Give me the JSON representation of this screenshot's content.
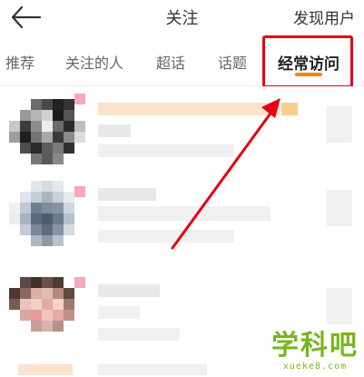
{
  "header": {
    "title": "关注",
    "discover_label": "发现用户",
    "back_icon": "arrow-left-icon"
  },
  "tabs": [
    {
      "label": "推荐"
    },
    {
      "label": "关注的人"
    },
    {
      "label": "超话"
    },
    {
      "label": "话题"
    },
    {
      "label": "经常访问",
      "active": true
    }
  ],
  "colors": {
    "accent": "#ff8200",
    "highlight": "#e60012",
    "watermark": "#7ab51d"
  },
  "watermark": {
    "main": "学科吧",
    "sub": "xueke8.com"
  }
}
